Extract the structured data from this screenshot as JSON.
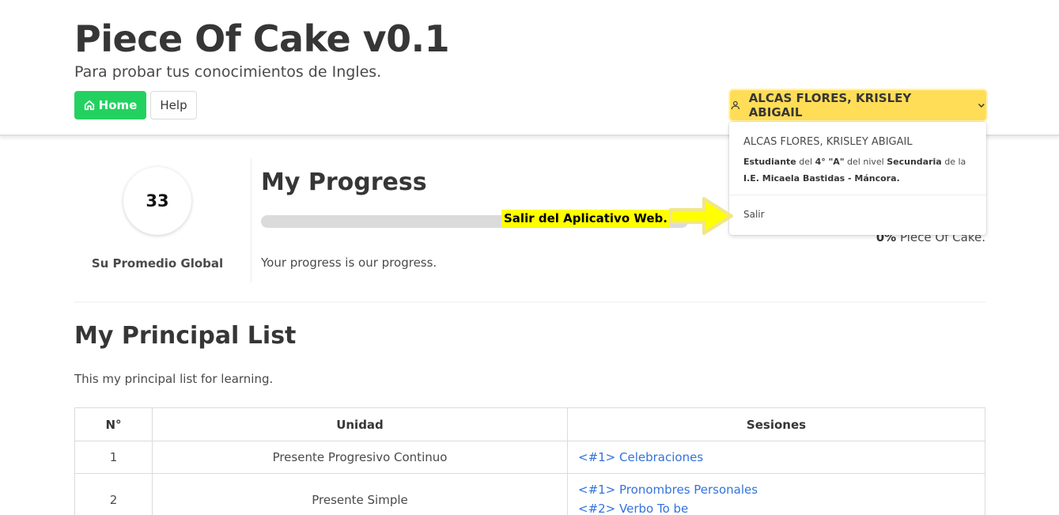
{
  "header": {
    "title": "Piece Of Cake v0.1",
    "subtitle": "Para probar tus conocimientos de Ingles.",
    "home_label": "Home",
    "help_label": "Help",
    "user_name": "ALCAS FLORES, KRISLEY ABIGAIL"
  },
  "user_menu": {
    "name": "ALCAS FLORES, KRISLEY ABIGAIL",
    "role": "Estudiante",
    "t_del": " del ",
    "grade": "4° \"A\"",
    "t_del_nivel": " del nivel ",
    "level": "Secundaria",
    "t_de_la": " de la ",
    "school": "I.E. Micaela Bastidas - Máncora.",
    "logout_label": "Salir"
  },
  "annotation": {
    "text": "Salir del Aplicativo Web.",
    "color": "#ffff00"
  },
  "summary": {
    "score": "33",
    "score_label": "Su Promedio Global"
  },
  "progress": {
    "title": "My Progress",
    "percent_value": 0,
    "percent_text": "0%",
    "caption_suffix": " Piece Of Cake.",
    "note": "Your progress is our progress."
  },
  "principal_list": {
    "title": "My Principal List",
    "description": "This my principal list for learning.",
    "columns": [
      "N°",
      "Unidad",
      "Sesiones"
    ],
    "rows": [
      {
        "n": "1",
        "unit": "Presente Progresivo Continuo",
        "sessions": [
          "<#1> Celebraciones"
        ]
      },
      {
        "n": "2",
        "unit": "Presente Simple",
        "sessions": [
          "<#1> Pronombres Personales",
          "<#2> Verbo To be"
        ]
      }
    ]
  },
  "colors": {
    "home_button": "#23d160",
    "user_button": "#ffdd57",
    "link": "#3273dc"
  }
}
